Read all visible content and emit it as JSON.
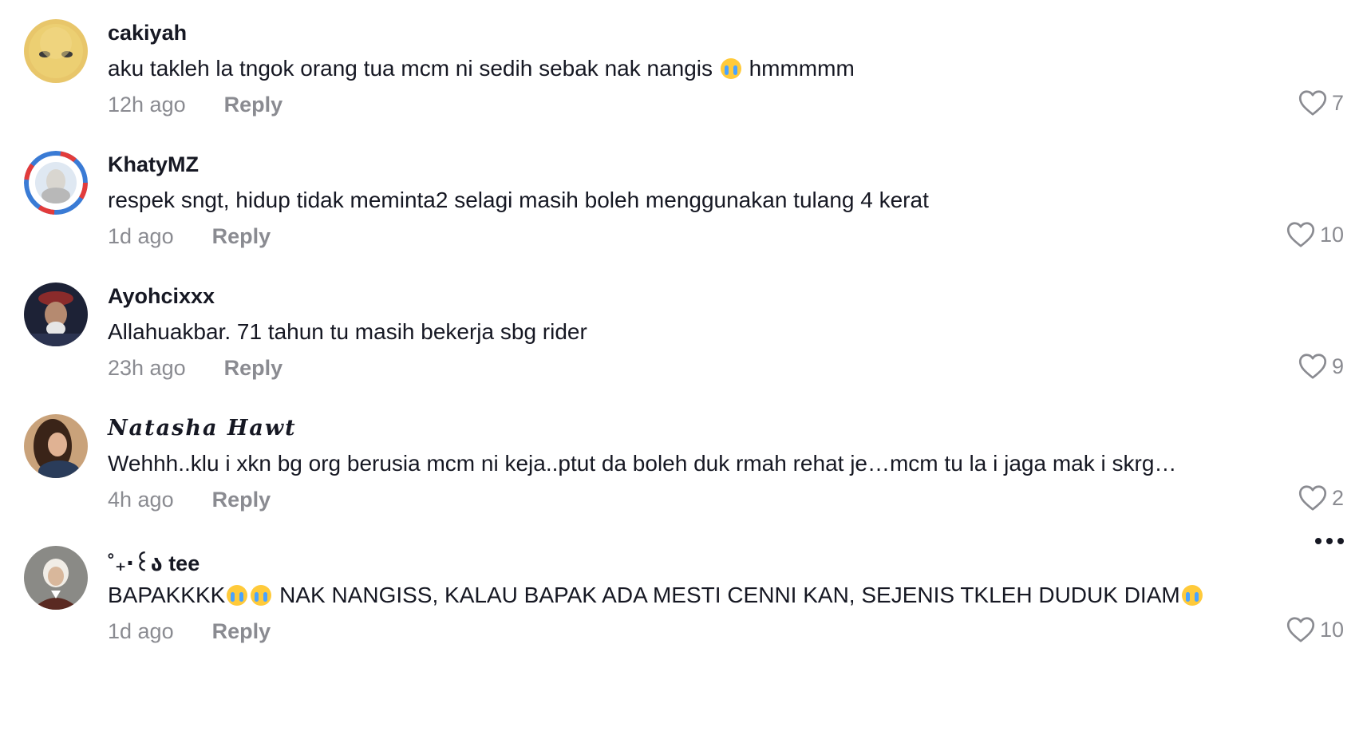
{
  "comments": [
    {
      "username": "cakiyah",
      "text_parts": [
        "aku takleh la tngok orang tua mcm ni sedih sebak nak nangis ",
        " hmmmmm"
      ],
      "time": "12h ago",
      "reply_label": "Reply",
      "likes": "7"
    },
    {
      "username": "KhatyMZ",
      "text": "respek sngt, hidup tidak meminta2 selagi masih boleh menggunakan tulang 4 kerat",
      "time": "1d ago",
      "reply_label": "Reply",
      "likes": "10"
    },
    {
      "username": "Ayohcixxx",
      "text": "Allahuakbar. 71 tahun tu masih bekerja sbg rider",
      "time": "23h ago",
      "reply_label": "Reply",
      "likes": "9"
    },
    {
      "username": "Natasha Hawt",
      "text": "Wehhh..klu i xkn bg org berusia mcm ni keja..ptut da boleh duk rmah rehat je…mcm tu la i jaga mak i skrg…",
      "time": "4h ago",
      "reply_label": "Reply",
      "likes": "2"
    },
    {
      "username": "˚₊‧꒰ა tee",
      "text_parts": [
        "BAPAKKKK",
        " NAK NANGISS, KALAU BAPAK ADA MESTI CENNI KAN, SEJENIS TKLEH DUDUK DIAM"
      ],
      "time": "1d ago",
      "reply_label": "Reply",
      "likes": "10"
    }
  ],
  "icons": {
    "like": "heart-outline-icon",
    "more": "more-horizontal-icon",
    "emoji": "loudly-crying-face-emoji"
  },
  "colors": {
    "text": "#161823",
    "muted": "#8a8b91",
    "background": "#ffffff"
  }
}
